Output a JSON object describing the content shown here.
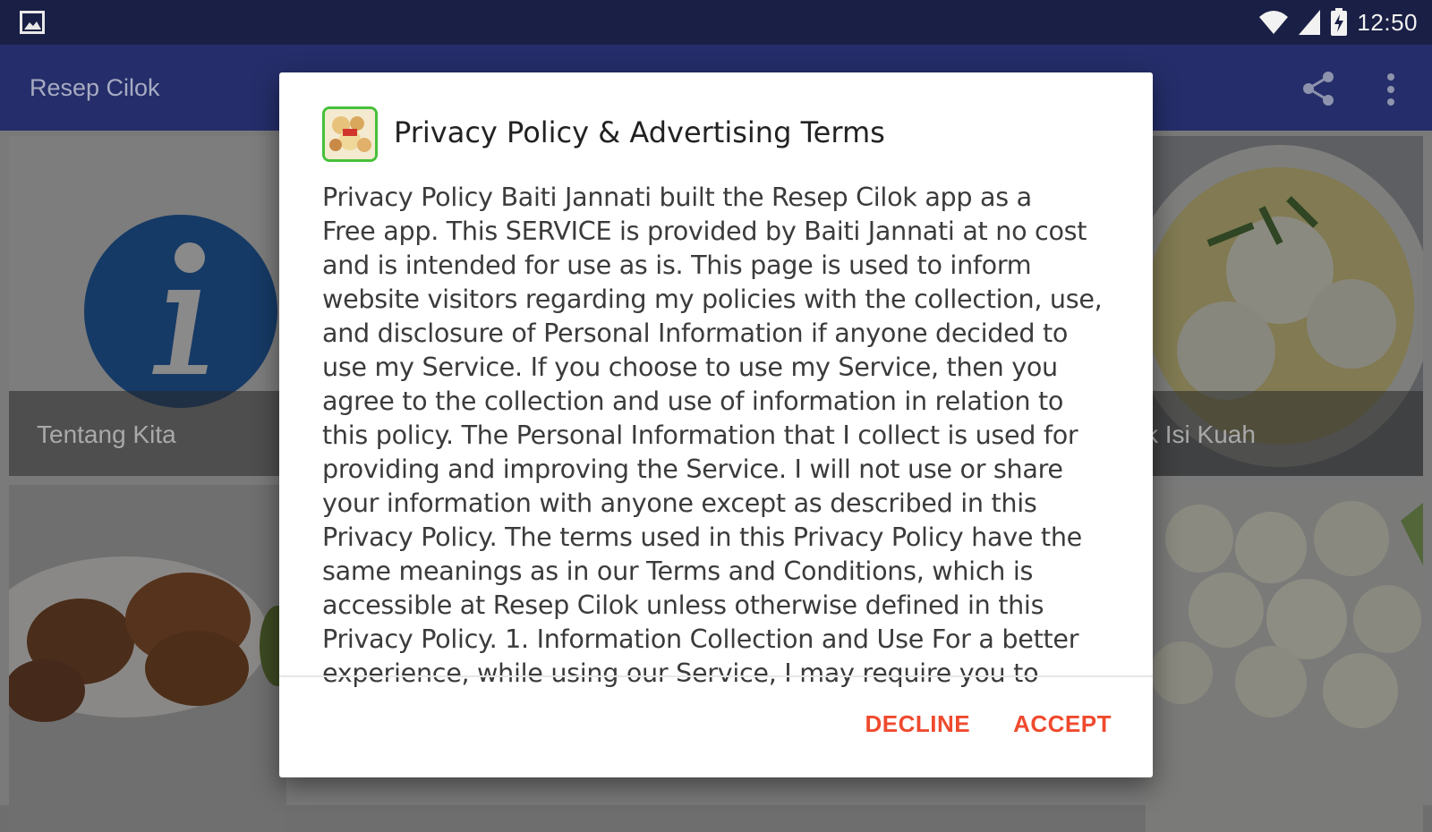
{
  "status_bar": {
    "time": "12:50",
    "icons": [
      "photo-icon",
      "wifi-icon",
      "cell-signal-icon",
      "battery-charging-icon"
    ]
  },
  "toolbar": {
    "title": "Resep Cilok",
    "actions": [
      "share-icon",
      "more-vert-icon"
    ]
  },
  "cards": [
    {
      "caption": "Tentang Kita",
      "icon": "info-icon"
    },
    {
      "caption": "k Isi Kuah"
    }
  ],
  "dialog": {
    "icon": "app-icon",
    "title": "Privacy Policy & Advertising Terms",
    "body_lines": [
      "Privacy Policy Baiti Jannati built the Resep Cilok app as a",
      "Free app. This SERVICE is provided by Baiti Jannati at no cost",
      "and is intended for use as is. This page is used to inform",
      "website visitors regarding my policies with the collection, use,",
      "and disclosure of Personal Information if anyone decided to",
      "use my Service. If you choose to use my Service, then you",
      "agree to the collection and use of information in relation to",
      "this policy. The Personal Information that I collect is used for",
      "providing and improving the Service. I will not use or share",
      "your information with anyone except as described in this",
      "Privacy Policy. The terms used in this Privacy Policy have the",
      "same meanings as in our Terms and Conditions, which is",
      "accessible at Resep Cilok unless otherwise defined in this",
      "Privacy Policy. 1. Information Collection and Use For a better",
      "experience, while using our Service, I may require you to"
    ],
    "decline_label": "DECLINE",
    "accept_label": "ACCEPT",
    "accent_color": "#ef4a2e"
  }
}
